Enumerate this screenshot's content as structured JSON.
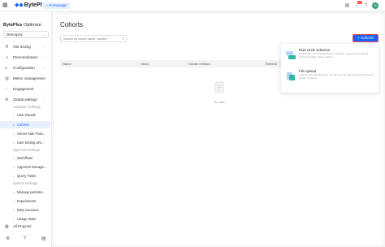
{
  "topbar": {
    "logo": "BytePlus",
    "breadcrumb": "Homepage",
    "notification_count": "8",
    "avatar_letter": "H"
  },
  "sidebar": {
    "brand_bold": "BytePlus",
    "brand_rest": "Optimize",
    "project": "Demoproj",
    "nav": [
      {
        "label": "A/B testing"
      },
      {
        "label": "Personalization"
      },
      {
        "label": "Configuration"
      },
      {
        "label": "Metric management"
      },
      {
        "label": "Engagement"
      },
      {
        "label": "Global settings"
      }
    ],
    "groups": [
      "Audience Settings",
      "Approval Settings",
      "System Settings"
    ],
    "subs": [
      "User Details",
      "Cohorts",
      "Server-side Para...",
      "User testing whi...",
      "Workflows",
      "Approval manage...",
      "Query Tasks",
      "Manage permiss...",
      "Experiments",
      "Data overview",
      "Usage Stats"
    ],
    "all_projects": "All Projects"
  },
  "main": {
    "title": "Cohorts",
    "search_placeholder": "Search by cohort name, owners",
    "columns": [
      "Name",
      "Users",
      "Create method",
      "Refresh"
    ],
    "empty_text": "No data",
    "create_button": "Cohorts",
    "dropdown": [
      {
        "title": "Rule circle selection",
        "desc": "Combination screening based on behavior, property and original cohort to flexibly create cohorts",
        "icon": "rule-icon"
      },
      {
        "title": "File upload",
        "desc": "Upload a file containing the user ID, you can directly create cohort of groups of people",
        "icon": "file-icon"
      }
    ]
  },
  "colors": {
    "accent": "#1664ff",
    "active_bg": "#e8efff",
    "danger": "#f53f3f"
  }
}
